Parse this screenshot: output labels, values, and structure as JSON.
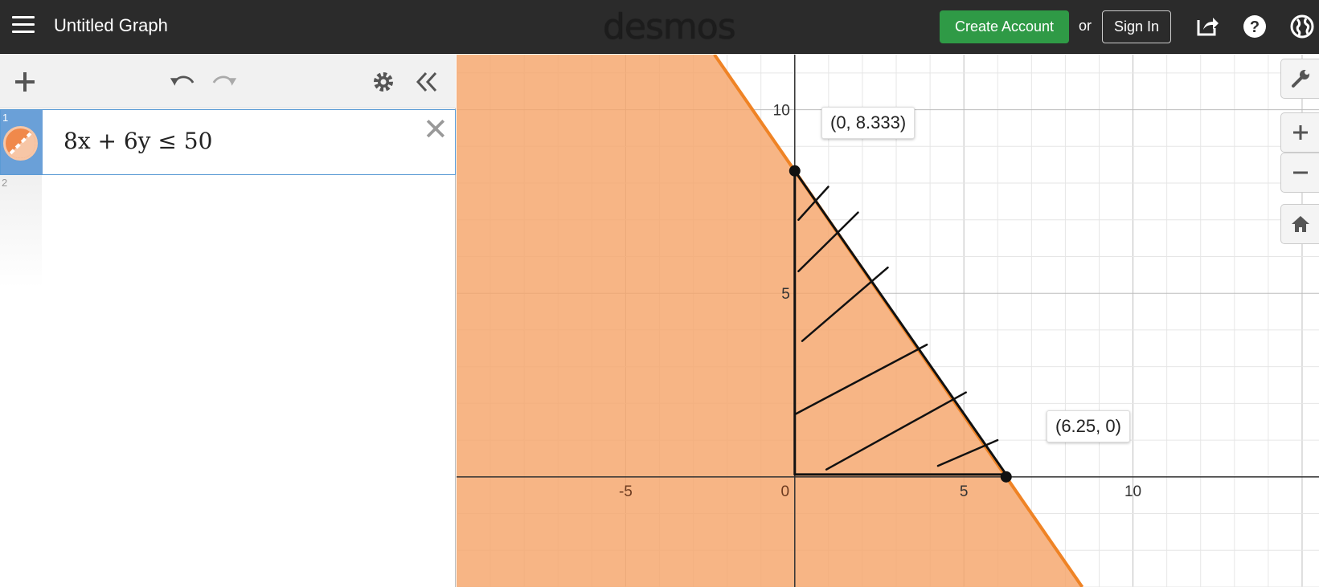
{
  "header": {
    "menu_icon": "hamburger-icon",
    "title": "Untitled Graph",
    "logo": "desmos",
    "create_account": "Create Account",
    "or": "or",
    "sign_in": "Sign In",
    "icons": [
      "share-icon",
      "help-icon",
      "language-globe-icon"
    ]
  },
  "expressions": {
    "toolbar_icons": [
      "add-icon",
      "undo-icon",
      "redo-icon",
      "settings-gear-icon",
      "collapse-panel-icon"
    ],
    "items": [
      {
        "number": "1",
        "latex": "8x + 6y ≤ 50",
        "color": "#f0894b"
      },
      {
        "number": "2",
        "latex": ""
      }
    ]
  },
  "graph": {
    "x_range": [
      -10,
      15.5
    ],
    "y_range": [
      -3,
      11.5
    ],
    "x_ticks": [
      "-5",
      "0",
      "5",
      "10"
    ],
    "y_ticks": [
      "5",
      "10"
    ],
    "grid": true,
    "shade_color": "#f5a56a",
    "line_color": "#ef8325",
    "points": [
      {
        "label": "(0, 8.333)",
        "x": 0,
        "y": 8.333
      },
      {
        "label": "(6.25, 0)",
        "x": 6.25,
        "y": 0
      }
    ],
    "side_buttons": [
      "wrench-icon",
      "zoom-in-icon",
      "zoom-out-icon",
      "home-icon"
    ]
  }
}
